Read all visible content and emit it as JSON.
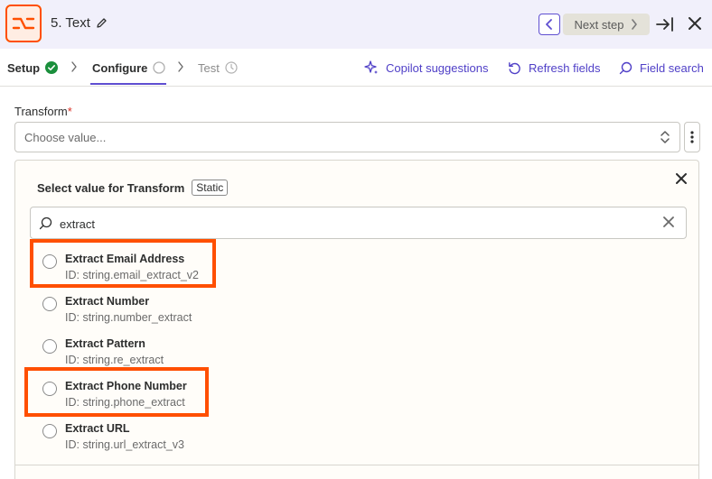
{
  "header": {
    "title": "5. Text",
    "next_step_label": "Next step"
  },
  "tabs": [
    {
      "label": "Setup",
      "status": "complete"
    },
    {
      "label": "Configure",
      "status": "in-progress"
    },
    {
      "label": "Test",
      "status": "pending"
    }
  ],
  "tools": {
    "copilot_label": "Copilot suggestions",
    "refresh_label": "Refresh fields",
    "field_search_label": "Field search"
  },
  "transform_field": {
    "label": "Transform",
    "required_marker": "*",
    "placeholder": "Choose value..."
  },
  "dropdown": {
    "title": "Select value for Transform",
    "badge": "Static",
    "search_value": "extract",
    "options": [
      {
        "name": "Extract Email Address",
        "id": "ID: string.email_extract_v2",
        "highlighted": true
      },
      {
        "name": "Extract Number",
        "id": "ID: string.number_extract",
        "highlighted": false
      },
      {
        "name": "Extract Pattern",
        "id": "ID: string.re_extract",
        "highlighted": false
      },
      {
        "name": "Extract Phone Number",
        "id": "ID: string.phone_extract",
        "highlighted": true
      },
      {
        "name": "Extract URL",
        "id": "ID: string.url_extract_v3",
        "highlighted": false
      }
    ]
  },
  "colors": {
    "accent": "#5f4fd1",
    "brand": "#ff4f00",
    "success": "#1a8f3c",
    "header_bg": "#f1f0fb"
  }
}
